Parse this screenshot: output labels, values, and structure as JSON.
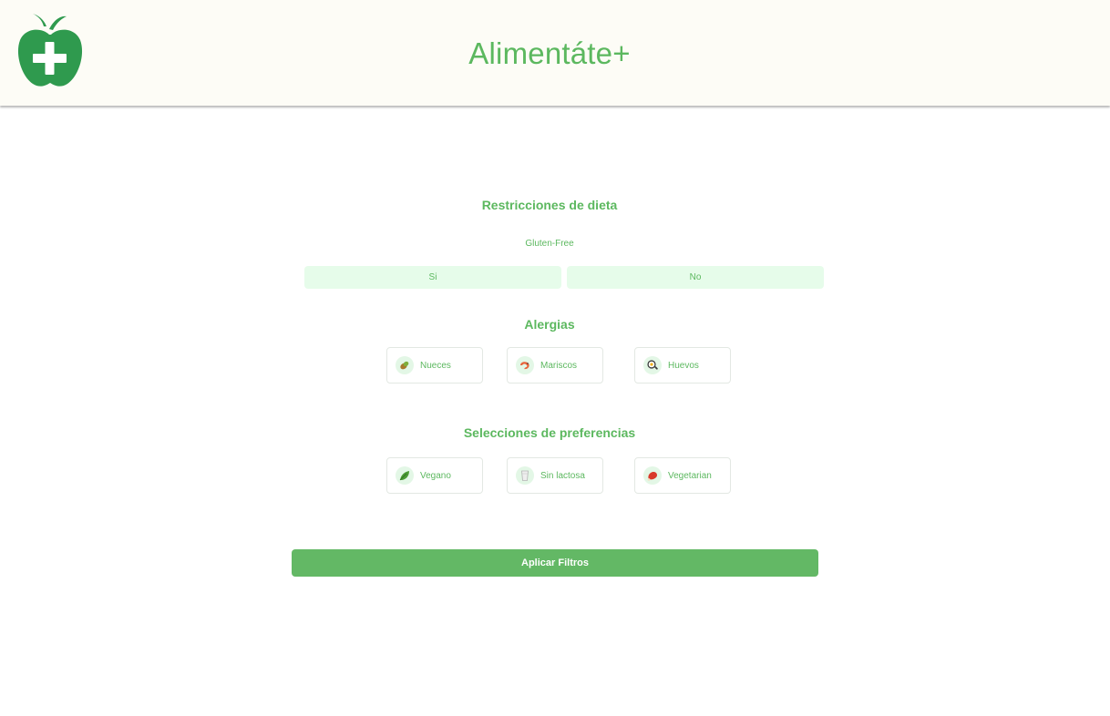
{
  "header": {
    "title": "Alimentáte+",
    "logo_icon": "apple-plus-icon"
  },
  "diet": {
    "title": "Restricciones de dieta",
    "gluten_label": "Gluten-Free",
    "yes_label": "Si",
    "no_label": "No"
  },
  "allergies": {
    "title": "Alergias",
    "items": [
      {
        "label": "Nueces",
        "icon": "nuts-icon"
      },
      {
        "label": "Mariscos",
        "icon": "shrimp-icon"
      },
      {
        "label": "Huevos",
        "icon": "egg-icon"
      }
    ]
  },
  "preferences": {
    "title": "Selecciones de preferencias",
    "items": [
      {
        "label": "Vegano",
        "icon": "leaf-icon"
      },
      {
        "label": "Sin lactosa",
        "icon": "glass-icon"
      },
      {
        "label": "Vegetarian",
        "icon": "meat-icon"
      }
    ]
  },
  "apply_label": "Aplicar Filtros",
  "colors": {
    "accent": "#5cb85f",
    "button": "#63b865",
    "logo": "#2f9a4e",
    "toggle_bg": "#e6fcea",
    "header_bg": "#fdfcf6"
  }
}
